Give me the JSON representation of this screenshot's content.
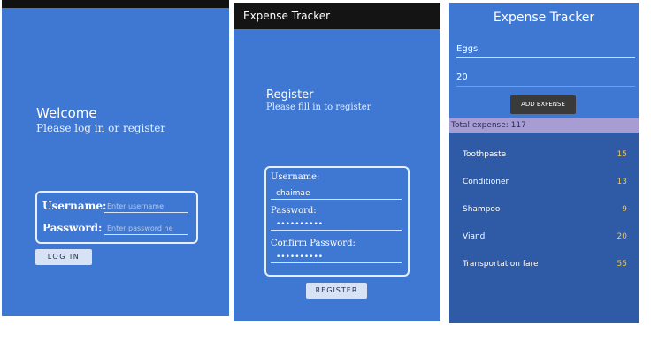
{
  "login": {
    "title": "Welcome",
    "subtitle": "Please log in or register",
    "username_label": "Username:",
    "username_placeholder": "Enter username",
    "password_label": "Password:",
    "password_placeholder": "Enter password he",
    "login_button": "LOG IN"
  },
  "register": {
    "app_title": "Expense Tracker",
    "title": "Register",
    "subtitle": "Please fill in to register",
    "username_label": "Username:",
    "username_value": "chaimae",
    "password_label": "Password:",
    "password_value": "••••••••••",
    "confirm_label": "Confirm Password:",
    "confirm_value": "••••••••••",
    "register_button": "REGISTER"
  },
  "tracker": {
    "title": "Expense Tracker",
    "name_value": "Eggs",
    "amount_value": "20",
    "add_button": "ADD EXPENSE",
    "total_text": "Total expense: 117",
    "items": [
      {
        "name": "Toothpaste",
        "amount": "15"
      },
      {
        "name": "Conditioner",
        "amount": "13"
      },
      {
        "name": "Shampoo",
        "amount": "9"
      },
      {
        "name": "Viand",
        "amount": "20"
      },
      {
        "name": "Transportation fare",
        "amount": "55"
      }
    ]
  },
  "colors": {
    "primary": "#3f78d2",
    "dark_bar": "#141414",
    "total_bar": "#a79dd3",
    "list_bg": "#2f5aa6",
    "amount_color": "#f0c74a"
  }
}
